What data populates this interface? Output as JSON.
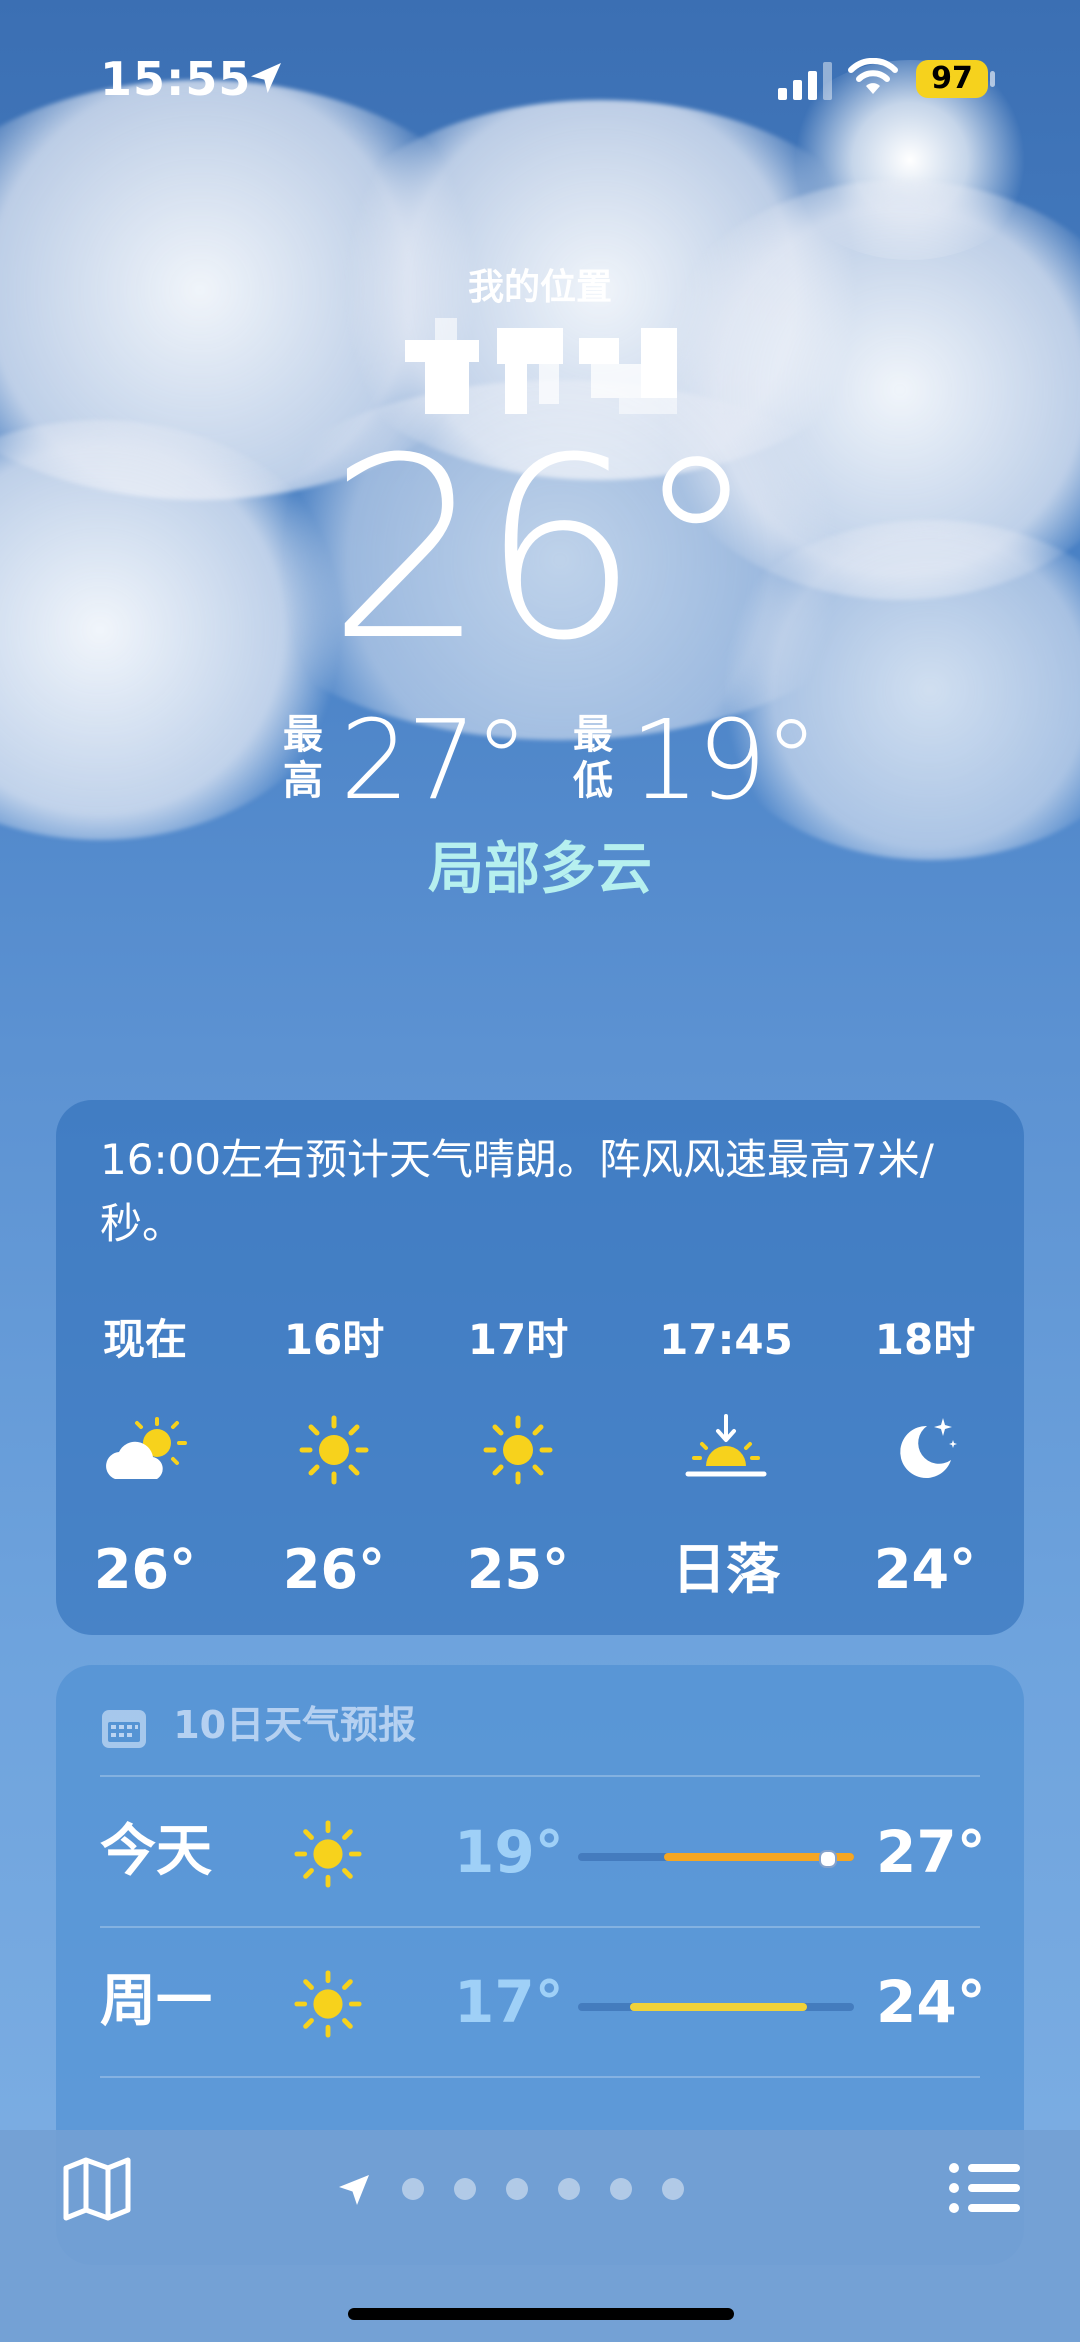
{
  "status_bar": {
    "time": "15:55",
    "battery": "97",
    "location_icon": "location-arrow-icon",
    "signal_icon": "cellular-signal-icon",
    "wifi_icon": "wifi-icon",
    "battery_color": "#f6d21d"
  },
  "header": {
    "location_label": "我的位置",
    "temperature": "26°",
    "high_label": "最高",
    "high_value": "27°",
    "low_label": "最低",
    "low_value": "19°",
    "condition": "局部多云",
    "condition_color": "#b6f0ef"
  },
  "hourly": {
    "summary": "16:00左右预计天气晴朗。阵风风速最高7米/秒。",
    "items": [
      {
        "label": "现在",
        "icon": "partly-cloudy-icon",
        "value": "26°"
      },
      {
        "label": "16时",
        "icon": "sun-icon",
        "value": "26°"
      },
      {
        "label": "17时",
        "icon": "sun-icon",
        "value": "25°"
      },
      {
        "label": "17:45",
        "icon": "sunset-icon",
        "value": "日落"
      },
      {
        "label": "18时",
        "icon": "moon-stars-icon",
        "value": "24°"
      }
    ]
  },
  "daily": {
    "title": "10日天气预报",
    "title_icon": "calendar-icon",
    "days": [
      {
        "name": "今天",
        "icon": "sun-icon",
        "low": "19°",
        "high": "27°",
        "bar_start": 0.31,
        "bar_end": 1.0,
        "current_pos": 0.9,
        "bar_color": "#f5a623"
      },
      {
        "name": "周一",
        "icon": "sun-icon",
        "low": "17°",
        "high": "24°",
        "bar_start": 0.19,
        "bar_end": 0.83,
        "bar_color": "#f0d23a"
      }
    ]
  },
  "bottom_bar": {
    "map_icon": "map-icon",
    "location_icon": "location-arrow-icon",
    "page_count": 7,
    "list_icon": "list-icon"
  }
}
